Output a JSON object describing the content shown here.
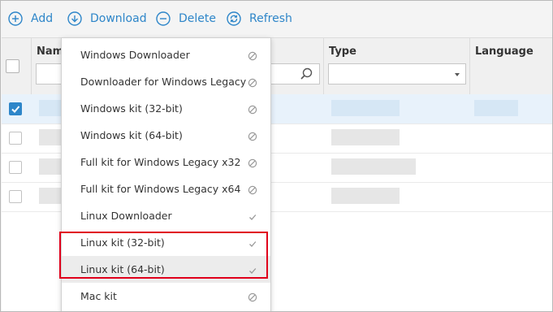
{
  "toolbar": {
    "add_label": "Add",
    "download_label": "Download",
    "delete_label": "Delete",
    "refresh_label": "Refresh",
    "accent_color": "#2e86c9"
  },
  "table": {
    "columns": [
      "Name",
      "Type",
      "Language"
    ],
    "type_filter_value": "",
    "name_filter_value": "",
    "rows": [
      {
        "checked": true,
        "selected": true
      },
      {
        "checked": false,
        "selected": false
      },
      {
        "checked": false,
        "selected": false
      },
      {
        "checked": false,
        "selected": false
      }
    ]
  },
  "download_menu": {
    "items": [
      {
        "label": "Windows Downloader",
        "status_icon": "disabled-icon"
      },
      {
        "label": "Downloader for Windows Legacy",
        "status_icon": "disabled-icon"
      },
      {
        "label": "Windows kit (32-bit)",
        "status_icon": "disabled-icon"
      },
      {
        "label": "Windows kit (64-bit)",
        "status_icon": "disabled-icon"
      },
      {
        "label": "Full kit for Windows Legacy x32",
        "status_icon": "disabled-icon"
      },
      {
        "label": "Full kit for Windows Legacy x64",
        "status_icon": "disabled-icon"
      },
      {
        "label": "Linux Downloader",
        "status_icon": "check-icon"
      },
      {
        "label": "Linux kit (32-bit)",
        "status_icon": "check-icon"
      },
      {
        "label": "Linux kit (64-bit)",
        "status_icon": "check-icon"
      },
      {
        "label": "Mac kit",
        "status_icon": "disabled-icon"
      }
    ],
    "highlight_color": "#e0001b"
  }
}
